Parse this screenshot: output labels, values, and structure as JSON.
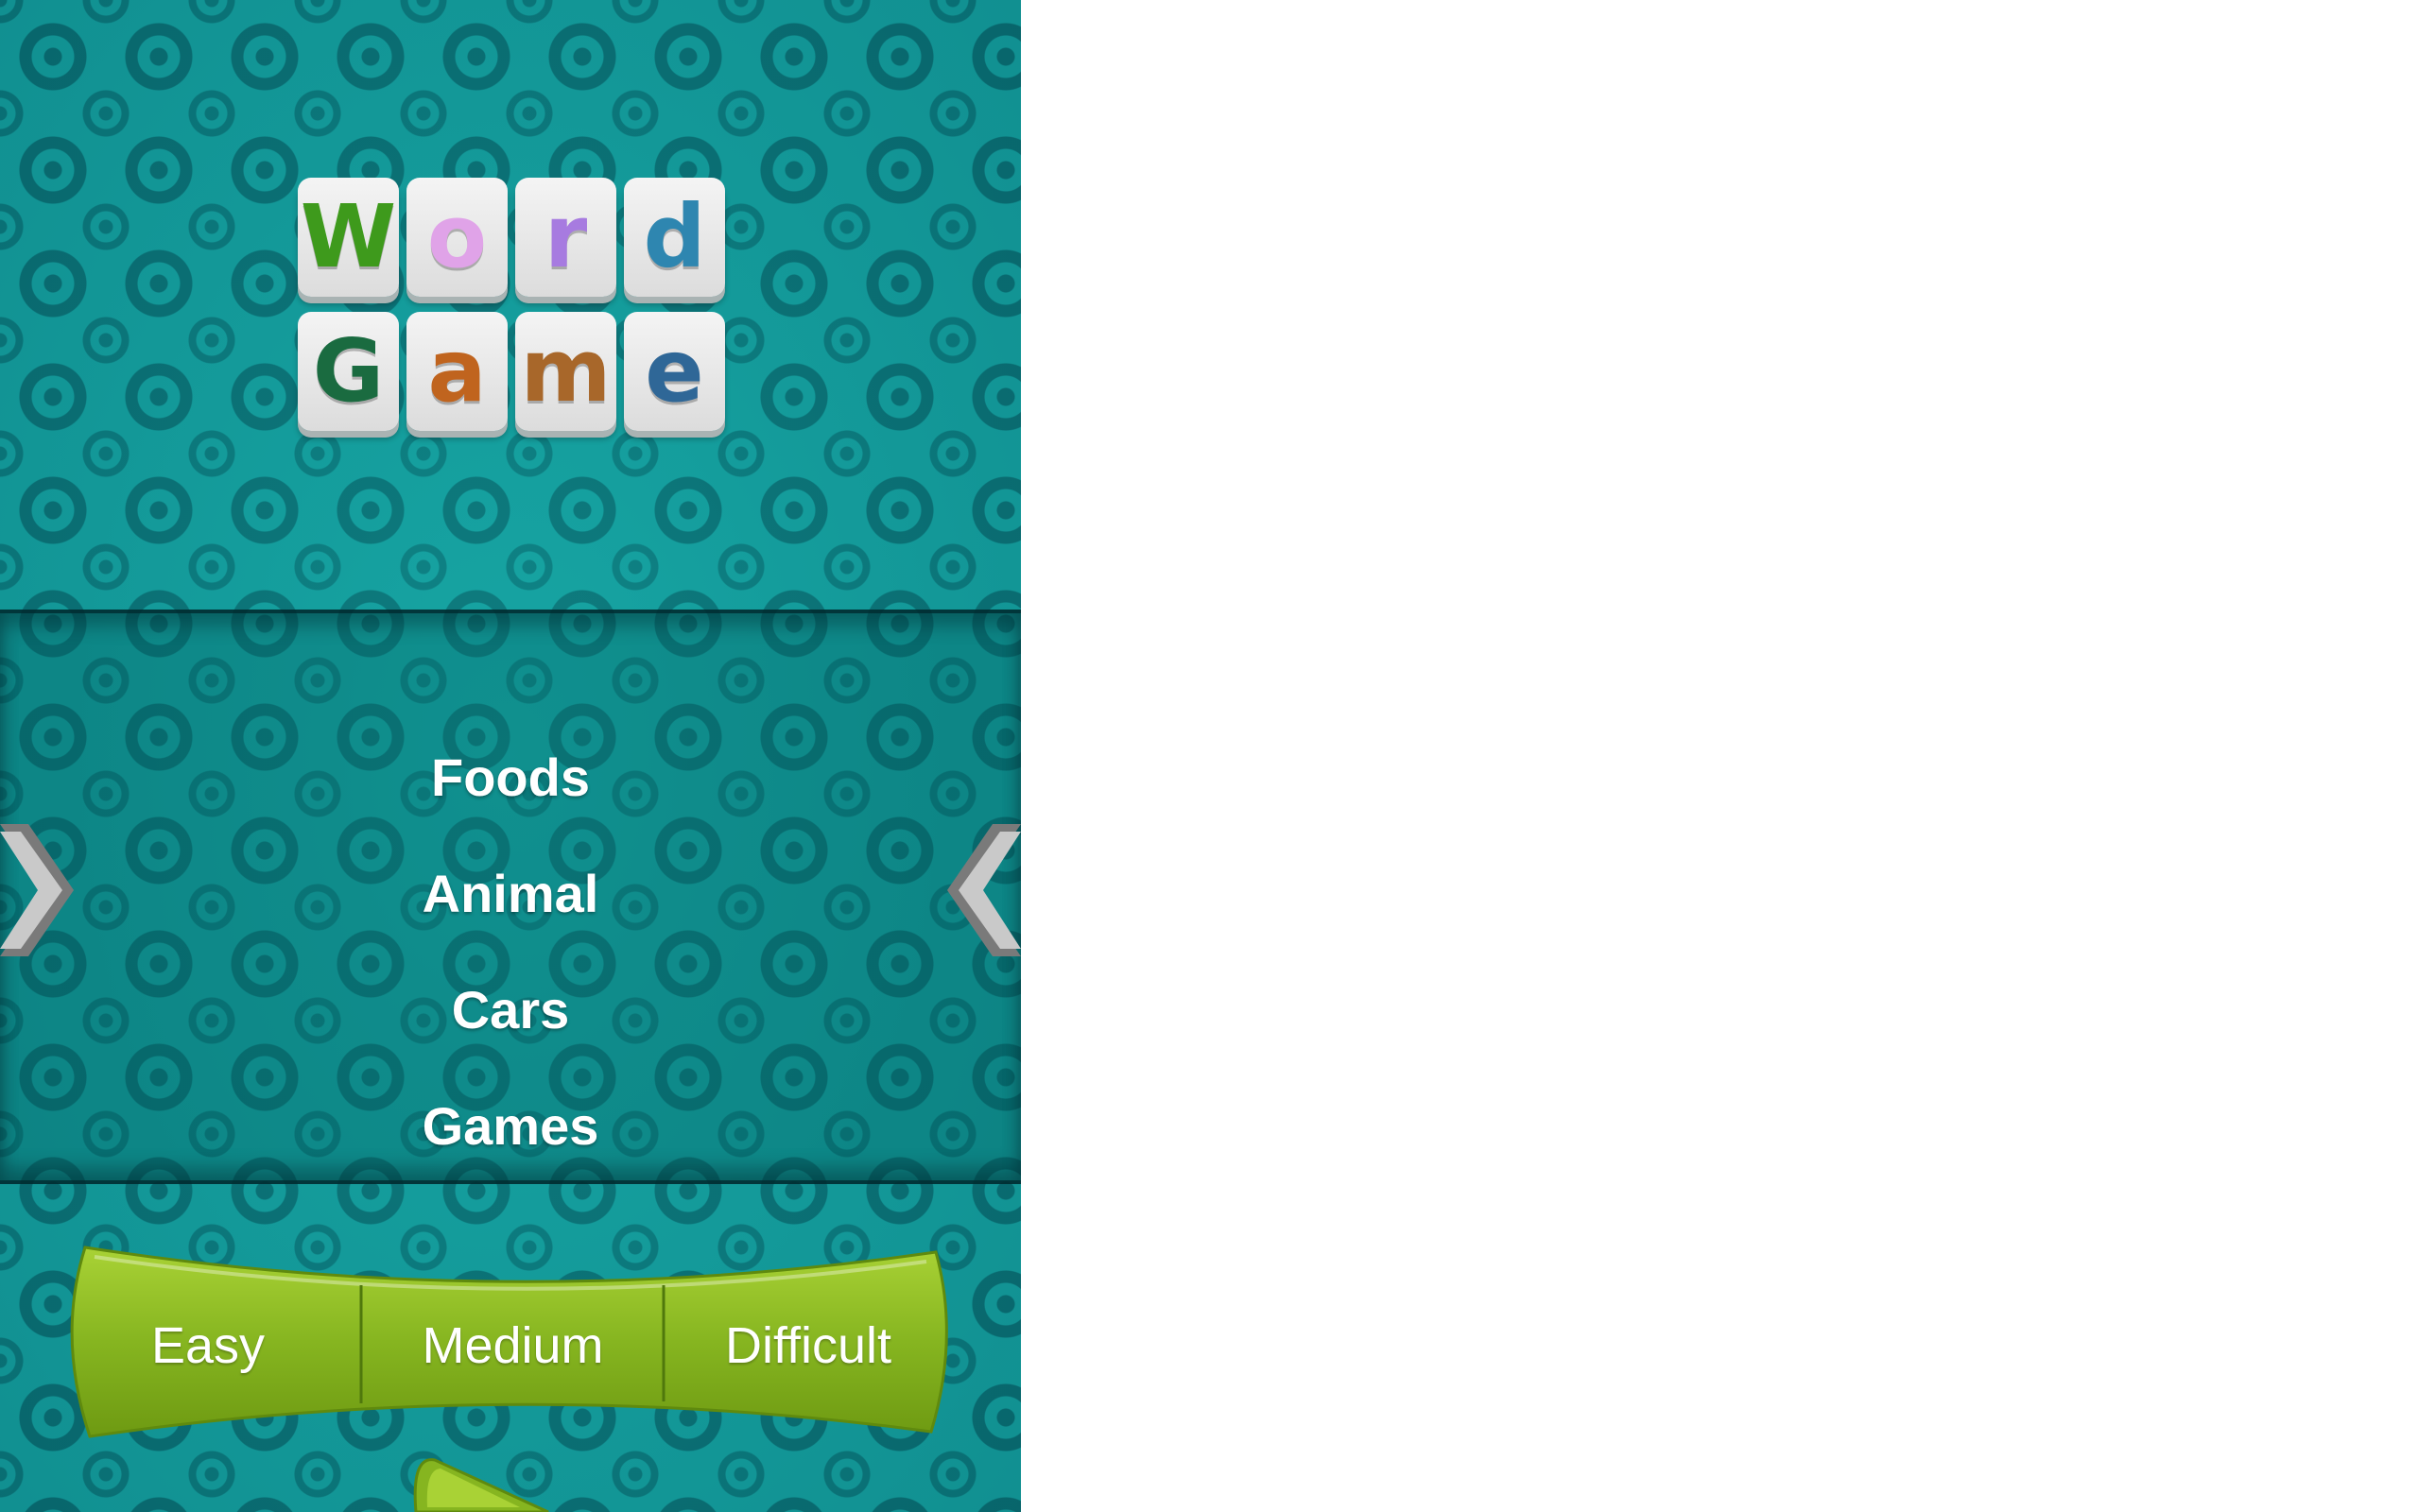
{
  "logo": {
    "row1": [
      {
        "letter": "W",
        "color": "#3e9a1c"
      },
      {
        "letter": "o",
        "color": "#e0a3e8"
      },
      {
        "letter": "r",
        "color": "#a77be0"
      },
      {
        "letter": "d",
        "color": "#2e86b0"
      }
    ],
    "row2": [
      {
        "letter": "G",
        "color": "#1a6b40"
      },
      {
        "letter": "a",
        "color": "#c0641e"
      },
      {
        "letter": "m",
        "color": "#a8672a"
      },
      {
        "letter": "e",
        "color": "#2f6797"
      }
    ]
  },
  "categories": [
    "Foods",
    "Animal",
    "Cars",
    "Games"
  ],
  "difficulty": {
    "easy": "Easy",
    "medium": "Medium",
    "difficult": "Difficult"
  },
  "icons": {
    "prev": "chevron-right-icon",
    "next": "chevron-left-icon",
    "play": "play-icon"
  },
  "colors": {
    "background": "#139e9e",
    "difficulty_bar": "#86b520"
  }
}
